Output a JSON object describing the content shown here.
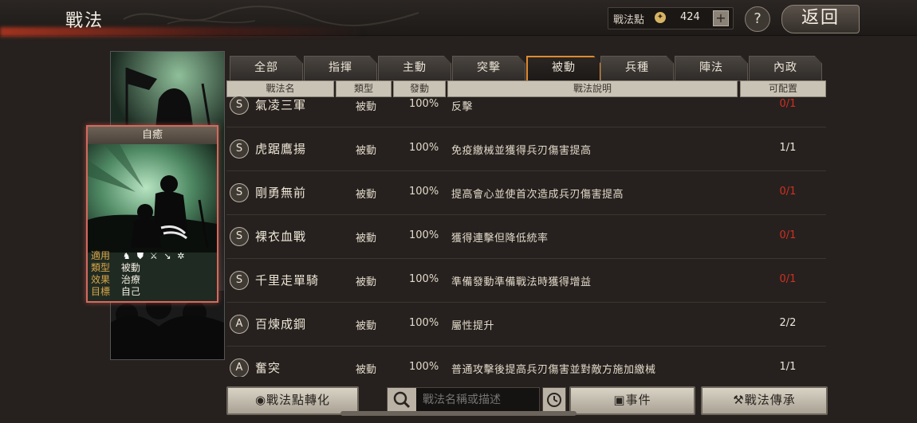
{
  "header": {
    "title": "戰法",
    "points_label": "戰法點",
    "points_value": "424",
    "plus": "+",
    "help": "?",
    "back": "返回"
  },
  "card": {
    "title": "自癒",
    "rows": [
      {
        "key": "適用",
        "value": ""
      },
      {
        "key": "類型",
        "value": "被動"
      },
      {
        "key": "效果",
        "value": "治療"
      },
      {
        "key": "目標",
        "value": "自己"
      }
    ],
    "applicable_icons": [
      "cavalry-icon",
      "shield-icon",
      "crossed-weapons-icon",
      "spear-icon",
      "wheel-icon"
    ]
  },
  "tabs": [
    {
      "label": "全部",
      "active": false
    },
    {
      "label": "指揮",
      "active": false
    },
    {
      "label": "主動",
      "active": false
    },
    {
      "label": "突擊",
      "active": false
    },
    {
      "label": "被動",
      "active": true
    },
    {
      "label": "兵種",
      "active": false
    },
    {
      "label": "陣法",
      "active": false
    },
    {
      "label": "內政",
      "active": false
    }
  ],
  "table": {
    "headers": [
      "戰法名",
      "類型",
      "發動",
      "戰法說明",
      "可配置"
    ],
    "rows": [
      {
        "grade": "S",
        "name": "氣凌三軍",
        "type": "被動",
        "rate": "100%",
        "desc": "反擊",
        "slot": "0/1",
        "slot_color": "#d12f24"
      },
      {
        "grade": "S",
        "name": "虎踞鷹揚",
        "type": "被動",
        "rate": "100%",
        "desc": "免疫繳械並獲得兵刃傷害提高",
        "slot": "1/1",
        "slot_color": "#ede7db"
      },
      {
        "grade": "S",
        "name": "剛勇無前",
        "type": "被動",
        "rate": "100%",
        "desc": "提高會心並使首次造成兵刃傷害提高",
        "slot": "0/1",
        "slot_color": "#d12f24"
      },
      {
        "grade": "S",
        "name": "裸衣血戰",
        "type": "被動",
        "rate": "100%",
        "desc": "獲得連擊但降低統率",
        "slot": "0/1",
        "slot_color": "#d12f24"
      },
      {
        "grade": "S",
        "name": "千里走單騎",
        "type": "被動",
        "rate": "100%",
        "desc": "準備發動準備戰法時獲得增益",
        "slot": "0/1",
        "slot_color": "#d12f24"
      },
      {
        "grade": "A",
        "name": "百煉成鋼",
        "type": "被動",
        "rate": "100%",
        "desc": "屬性提升",
        "slot": "2/2",
        "slot_color": "#ede7db"
      },
      {
        "grade": "A",
        "name": "奮突",
        "type": "被動",
        "rate": "100%",
        "desc": "普通攻擊後提高兵刃傷害並對敵方施加繳械",
        "slot": "1/1",
        "slot_color": "#ede7db"
      }
    ]
  },
  "bottom": {
    "convert_label": "戰法點轉化",
    "search_placeholder": "戰法名稱或描述",
    "events_label": "事件",
    "inherit_label": "戰法傳承"
  },
  "colors": {
    "accent_orange": "#e08a2f",
    "slot_red": "#d12f24",
    "card_border": "#d36a5e",
    "label_gold": "#d9a648"
  }
}
